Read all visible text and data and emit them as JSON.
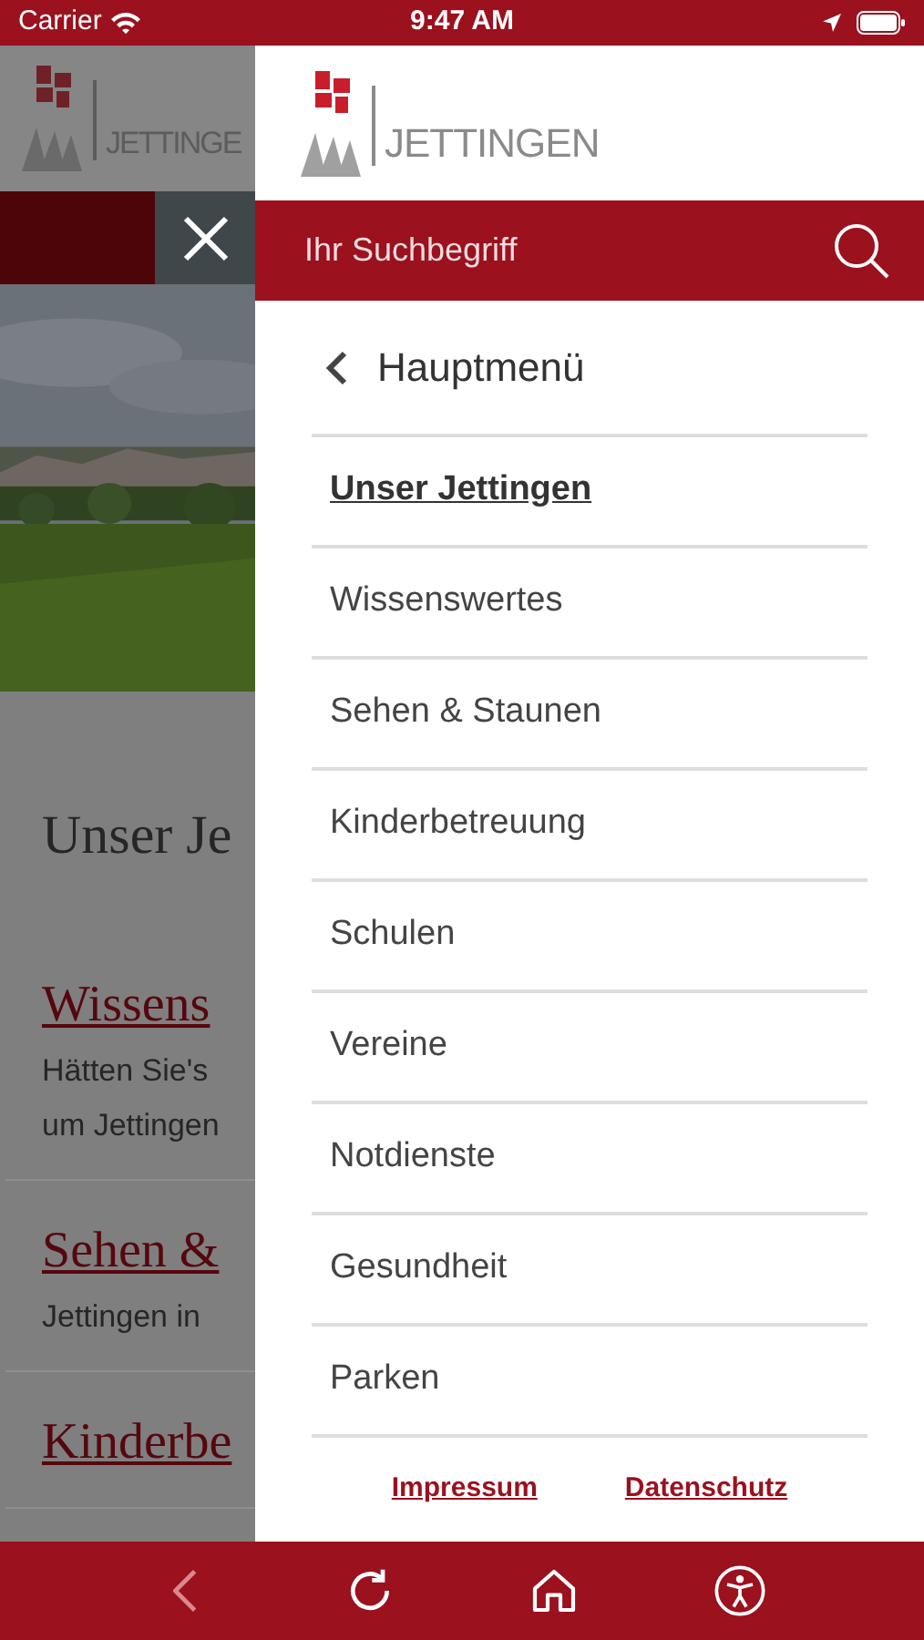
{
  "status_bar": {
    "carrier": "Carrier",
    "time": "9:47 AM"
  },
  "background_page": {
    "logo_text": "JETTINGE",
    "title": "Unser Je",
    "entries": [
      {
        "title": "Wissens",
        "lines": [
          "Hätten Sie's",
          "um Jettingen"
        ]
      },
      {
        "title": "Sehen &",
        "lines": [
          "Jettingen in"
        ]
      },
      {
        "title": "Kinderbe"
      }
    ]
  },
  "drawer": {
    "logo_text": "JETTINGEN",
    "search": {
      "placeholder": "Ihr Suchbegriff"
    },
    "back_label": "Hauptmenü",
    "items": [
      {
        "label": "Unser Jettingen",
        "selected": true
      },
      {
        "label": "Wissenswertes",
        "selected": false
      },
      {
        "label": "Sehen & Staunen",
        "selected": false
      },
      {
        "label": "Kinderbetreuung",
        "selected": false
      },
      {
        "label": "Schulen",
        "selected": false
      },
      {
        "label": "Vereine",
        "selected": false
      },
      {
        "label": "Notdienste",
        "selected": false
      },
      {
        "label": "Gesundheit",
        "selected": false
      },
      {
        "label": "Parken",
        "selected": false
      }
    ],
    "footer_links": [
      "Impressum",
      "Datenschutz"
    ]
  },
  "bottom_bar": [
    {
      "kind": "back",
      "disabled": true
    },
    {
      "kind": "reload",
      "disabled": false
    },
    {
      "kind": "home",
      "disabled": false
    },
    {
      "kind": "accessibility",
      "disabled": false
    }
  ]
}
